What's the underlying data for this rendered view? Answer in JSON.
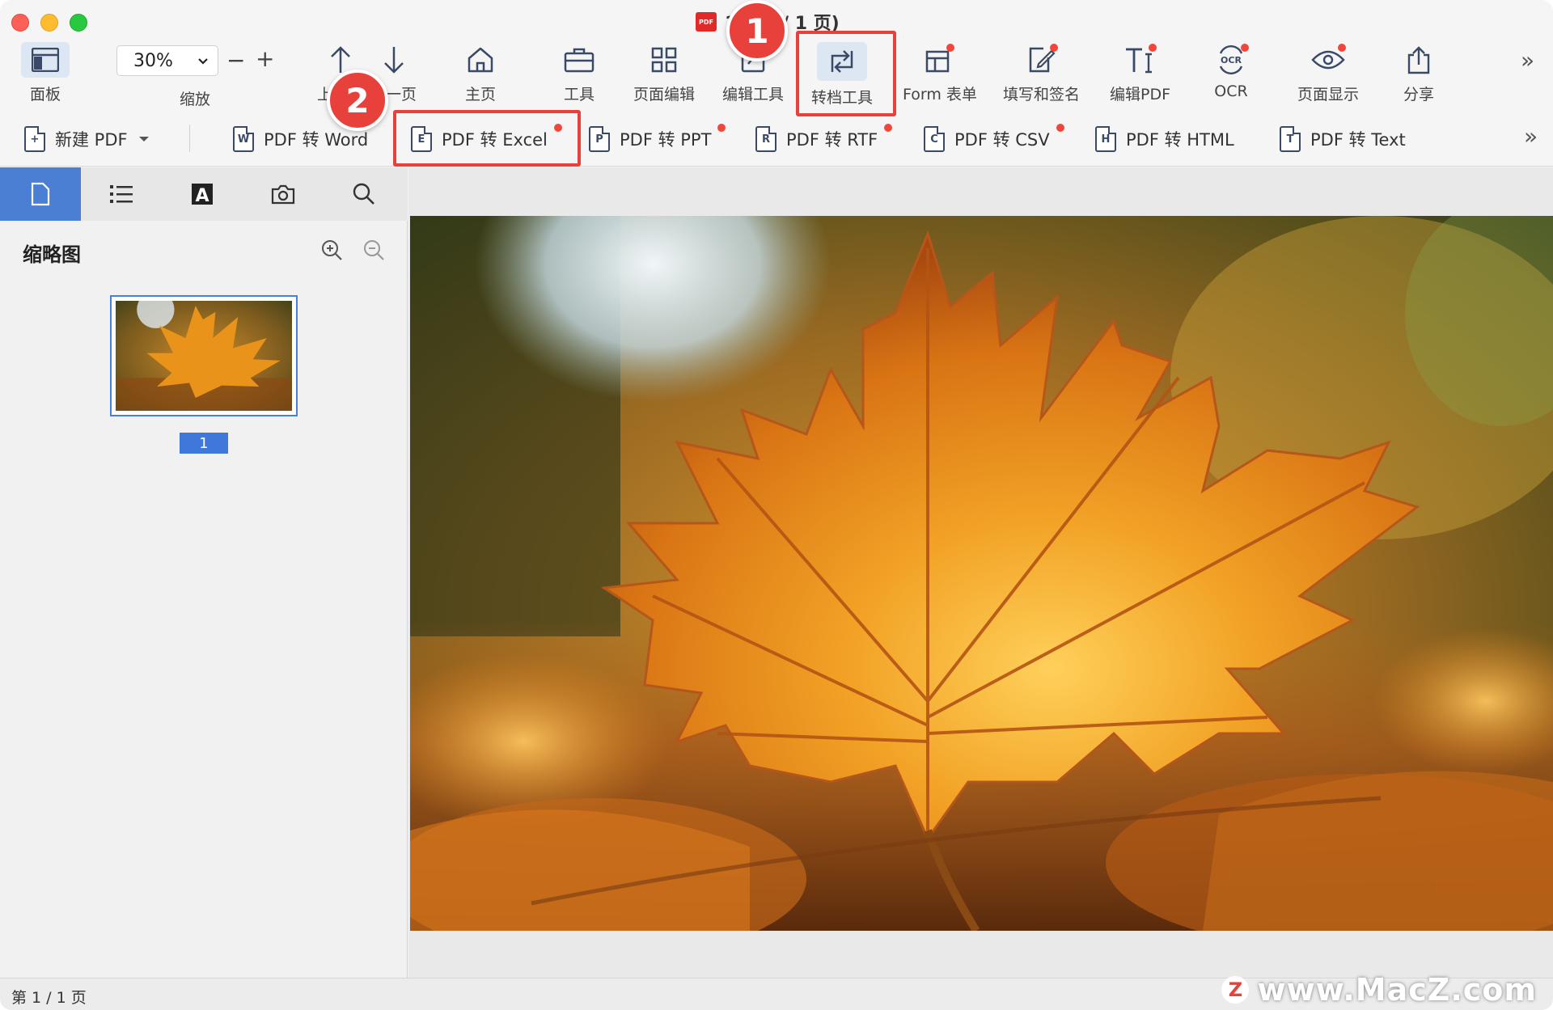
{
  "window": {
    "title": "1... 1 / 1 页)"
  },
  "toolbar": {
    "panel_label": "面板",
    "zoom_value": "30%",
    "zoom_label": "缩放",
    "prev_label": "上一页",
    "next_label": "下一页",
    "home_label": "主页",
    "tools_label": "工具",
    "page_edit_label": "页面编辑",
    "edit_tools_label": "编辑工具",
    "convert_tools_label": "转档工具",
    "form_label": "Form 表单",
    "fill_sign_label": "填写和签名",
    "edit_pdf_label": "编辑PDF",
    "ocr_label": "OCR",
    "page_display_label": "页面显示",
    "share_label": "分享"
  },
  "convert": {
    "new_pdf": "新建 PDF",
    "items": [
      {
        "letter": "W",
        "label": "PDF 转 Word"
      },
      {
        "letter": "E",
        "label": "PDF 转 Excel"
      },
      {
        "letter": "P",
        "label": "PDF 转 PPT"
      },
      {
        "letter": "R",
        "label": "PDF 转 RTF"
      },
      {
        "letter": "C",
        "label": "PDF 转 CSV"
      },
      {
        "letter": "H",
        "label": "PDF 转 HTML"
      },
      {
        "letter": "T",
        "label": "PDF 转 Text"
      }
    ]
  },
  "annotations": {
    "step1": "1",
    "step2": "2"
  },
  "sidebar": {
    "title": "缩略图",
    "page_number": "1"
  },
  "status": {
    "page_info": "第 1 / 1 页"
  },
  "watermark": {
    "logo": "Z",
    "text": "www.MacZ.com"
  },
  "colors": {
    "accent": "#4a7fd4",
    "annotation_red": "#e8413c",
    "notification_dot": "#f0463c"
  }
}
